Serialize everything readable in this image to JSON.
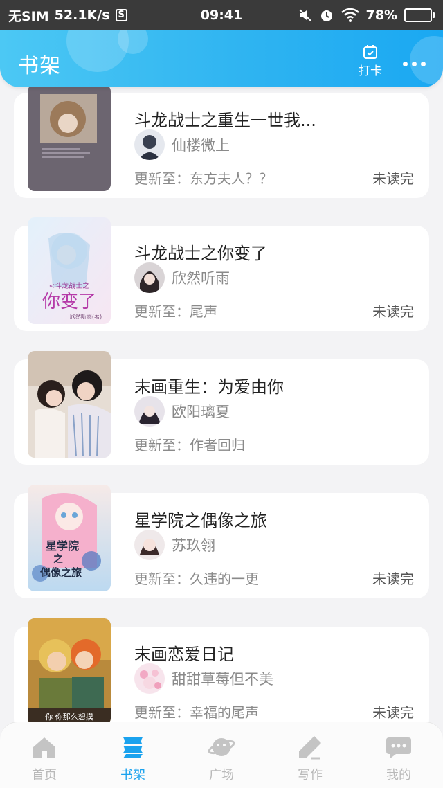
{
  "status_bar": {
    "carrier": "无SIM",
    "speed": "52.1K/s",
    "s_badge": "S",
    "time": "09:41",
    "battery": "78%",
    "battery_level": 0.78
  },
  "header": {
    "title": "书架",
    "checkin_label": "打卡"
  },
  "books": [
    {
      "title": "斗龙战士之重生一世我...",
      "author": "仙楼微上",
      "update_prefix": "更新至：",
      "update": "东方夫人？？",
      "status": "未读完"
    },
    {
      "title": "斗龙战士之你变了",
      "author": "欣然听雨",
      "update_prefix": "更新至：",
      "update": "尾声",
      "status": "未读完",
      "cover_text_top": "<斗龙战士之",
      "cover_text_main": "你变了",
      "cover_text_small": "欣然听雨(著)"
    },
    {
      "title": "末画重生：为爱由你",
      "author": "欧阳璃夏",
      "update_prefix": "更新至：",
      "update": "作者回归",
      "status": ""
    },
    {
      "title": "星学院之偶像之旅",
      "author": "苏玖翎",
      "update_prefix": "更新至：",
      "update": "久违的一更",
      "status": "未读完",
      "cover_text_1": "星学院",
      "cover_text_2": "之",
      "cover_text_3": "偶像之旅"
    },
    {
      "title": "末画恋爱日记",
      "author": "甜甜草莓但不美",
      "update_prefix": "更新至：",
      "update": "幸福的尾声",
      "status": "未读完",
      "cover_caption": "你 你那么想摸"
    }
  ],
  "nav": [
    {
      "label": "首页",
      "icon": "home-icon",
      "active": false
    },
    {
      "label": "书架",
      "icon": "bookshelf-icon",
      "active": true
    },
    {
      "label": "广场",
      "icon": "planet-icon",
      "active": false
    },
    {
      "label": "写作",
      "icon": "pen-icon",
      "active": false
    },
    {
      "label": "我的",
      "icon": "chat-icon",
      "active": false
    }
  ],
  "colors": {
    "accent": "#1aa2ee",
    "header_start": "#4cc8f4",
    "header_end": "#1aa8f2",
    "background": "#f3f3f5"
  }
}
